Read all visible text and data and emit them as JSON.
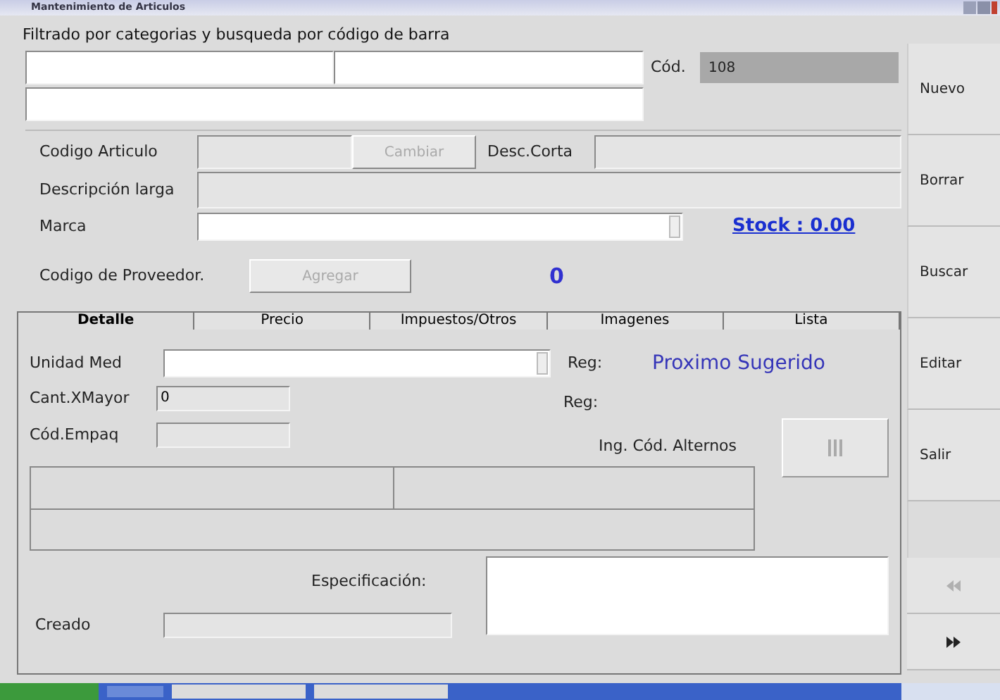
{
  "window": {
    "title": "Mantenimiento de Articulos"
  },
  "filter": {
    "label": "Filtrado por categorias y busqueda por código de barra",
    "cod_label": "Cód.",
    "cod_value": "108"
  },
  "article": {
    "codigo_label": "Codigo Articulo",
    "cambiar_button": {
      "label": "Cambiar",
      "disabled": true
    },
    "desc_corta_label": "Desc.Corta",
    "desc_larga_label": "Descripción larga",
    "marca_label": "Marca",
    "stock_link": "Stock : 0.00",
    "proveedor_label": "Codigo de Proveedor.",
    "agregar_button": {
      "label": "Agregar",
      "disabled": true
    },
    "proveedor_count": "0"
  },
  "tabs": [
    {
      "label": "Detalle",
      "selected": true
    },
    {
      "label": "Precio",
      "selected": false
    },
    {
      "label": "Impuestos/Otros",
      "selected": false
    },
    {
      "label": "Imagenes",
      "selected": false
    },
    {
      "label": "Lista",
      "selected": false
    }
  ],
  "detalle": {
    "unidad_label": "Unidad Med",
    "reg_label_1": "Reg:",
    "proximo": "Proximo Sugerido",
    "cant_label": "Cant.XMayor",
    "cant_value": "0",
    "reg_label_2": "Reg:",
    "empaq_label": "Cód.Empaq",
    "alternos_label": "Ing. Cód. Alternos",
    "especificacion_label": "Especificación:",
    "creado_label": "Creado"
  },
  "side_buttons": [
    {
      "label": "Nuevo"
    },
    {
      "label": "Borrar"
    },
    {
      "label": "Buscar"
    },
    {
      "label": "Editar"
    },
    {
      "label": "Salir"
    }
  ],
  "nav_buttons": [
    {
      "kind": "previous",
      "disabled": true
    },
    {
      "kind": "next",
      "disabled": false
    }
  ]
}
